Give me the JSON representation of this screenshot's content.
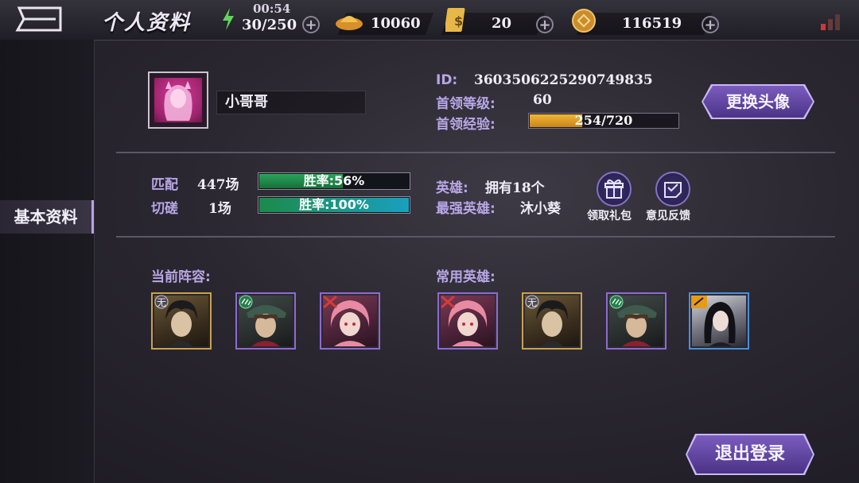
{
  "topbar": {
    "title": "个人资料",
    "clock": "00:54",
    "stamina": "30/250",
    "gold": "10060",
    "tickets": "20",
    "coins": "116519"
  },
  "sidebar": {
    "tabs": [
      {
        "label": "基本资料"
      }
    ]
  },
  "profile": {
    "name": "小哥哥",
    "id_label": "ID:",
    "id_value": "3603506225290749835",
    "level_label": "首领等级:",
    "level_value": "60",
    "exp_label": "首领经验:",
    "exp_text": "254/720",
    "exp_fraction": 0.353,
    "change_avatar": "更换头像"
  },
  "stats": {
    "match_label": "匹配",
    "match_count": "447场",
    "match_winrate": "胜率:56%",
    "match_fraction": 0.56,
    "spar_label": "切磋",
    "spar_count": "1场",
    "spar_winrate": "胜率:100%",
    "spar_fraction": 1.0,
    "heroes_label": "英雄:",
    "heroes_value": "拥有18个",
    "strongest_label": "最强英雄:",
    "strongest_value": "沐小葵",
    "gift_label": "领取礼包",
    "feedback_label": "意见反馈"
  },
  "sections": {
    "current_lineup": "当前阵容:",
    "frequent_heroes": "常用英雄:"
  },
  "tags": {
    "none": "无"
  },
  "actions": {
    "logout": "退出登录"
  },
  "colors": {
    "accent_label": "#b8a6e6",
    "button_purple": "#5b3f9a",
    "exp_gold": "#e8a42a",
    "winrate_green": "#1f8a4a",
    "winrate_blue": "#1d7fb3"
  }
}
